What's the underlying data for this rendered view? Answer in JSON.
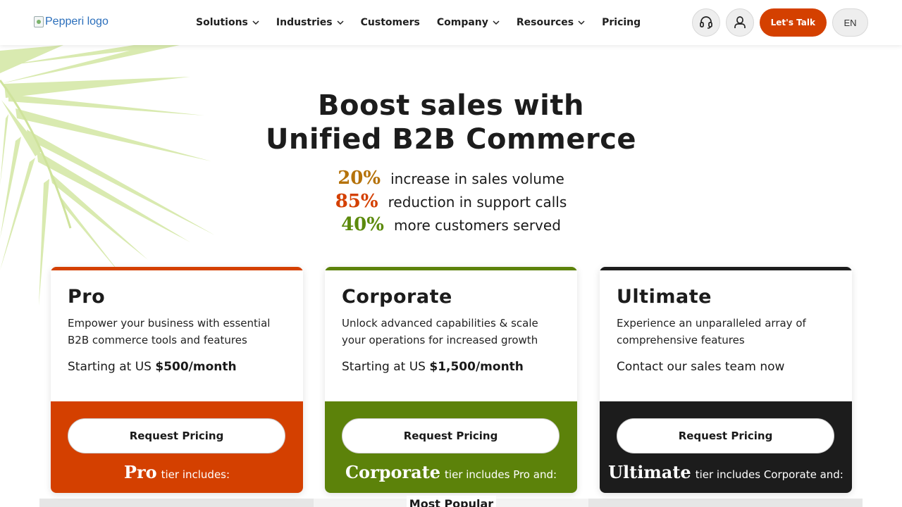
{
  "header": {
    "logo_alt": "Pepperi logo",
    "nav": [
      {
        "label": "Solutions",
        "dropdown": true
      },
      {
        "label": "Industries",
        "dropdown": true
      },
      {
        "label": "Customers",
        "dropdown": false
      },
      {
        "label": "Company",
        "dropdown": true
      },
      {
        "label": "Resources",
        "dropdown": true
      },
      {
        "label": "Pricing",
        "dropdown": false
      }
    ],
    "support_icon": "headset-icon",
    "account_icon": "user-icon",
    "cta_label": "Let's Talk",
    "language": "EN"
  },
  "hero": {
    "title_line1": "Boost sales with",
    "title_line2": "Unified B2B Commerce",
    "stats": [
      {
        "value": "20%",
        "text": "increase in sales volume",
        "color": "#b5720a"
      },
      {
        "value": "85%",
        "text": "reduction in support calls",
        "color": "#d44000"
      },
      {
        "value": "40%",
        "text": "more customers served",
        "color": "#5c8a0c"
      }
    ]
  },
  "plans": [
    {
      "name": "Pro",
      "description": "Empower your business with essential B2B commerce tools and features",
      "price_prefix": "Starting at US ",
      "price": "$500/month",
      "button": "Request Pricing",
      "tier_name": "Pro",
      "tier_includes": "tier includes:",
      "color": "#d44000"
    },
    {
      "name": "Corporate",
      "description": "Unlock advanced capabilities & scale your operations for increased growth",
      "price_prefix": "Starting at US ",
      "price": "$1,500/month",
      "button": "Request Pricing",
      "tier_name": "Corporate",
      "tier_includes": "tier includes Pro and:",
      "color": "#5c820a"
    },
    {
      "name": "Ultimate",
      "description": "Experience an unparalleled array of comprehensive features",
      "price_prefix": "Contact our sales team now",
      "price": "",
      "button": "Request Pricing",
      "tier_name": "Ultimate",
      "tier_includes": "tier includes Corporate and:",
      "color": "#1c1c1c"
    }
  ],
  "badge": "Most Popular",
  "colors": {
    "accent": "#d44000",
    "leaf": "#d9eab0"
  }
}
